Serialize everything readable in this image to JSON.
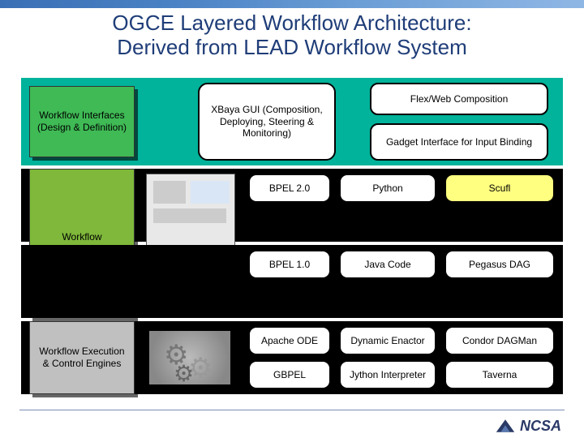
{
  "title_line1": "OGCE Layered Workflow Architecture:",
  "title_line2": "Derived from LEAD Workflow System",
  "layers": {
    "interfaces": {
      "label": "Workflow Interfaces (Design & Definition)",
      "xbaya": "XBaya GUI (Composition, Deploying, Steering & Monitoring)",
      "flex": "Flex/Web Composition",
      "gadget": "Gadget Interface for Input Binding"
    },
    "specification": {
      "label": "Workflow Specification",
      "cells": {
        "r0c0": "BPEL 2.0",
        "r0c1": "Python",
        "r0c2": "Scufl",
        "r1c0": "BPEL 1.0",
        "r1c1": "Java Code",
        "r1c2": "Pegasus DAG"
      }
    },
    "execution": {
      "label": "Workflow Execution & Control Engines",
      "cells": {
        "r0c0": "Apache ODE",
        "r0c1": "Dynamic Enactor",
        "r0c2": "Condor DAGMan",
        "r1c0": "GBPEL",
        "r1c1": "Jython Interpreter",
        "r1c2": "Taverna"
      }
    }
  },
  "footer": {
    "org": "NCSA"
  }
}
